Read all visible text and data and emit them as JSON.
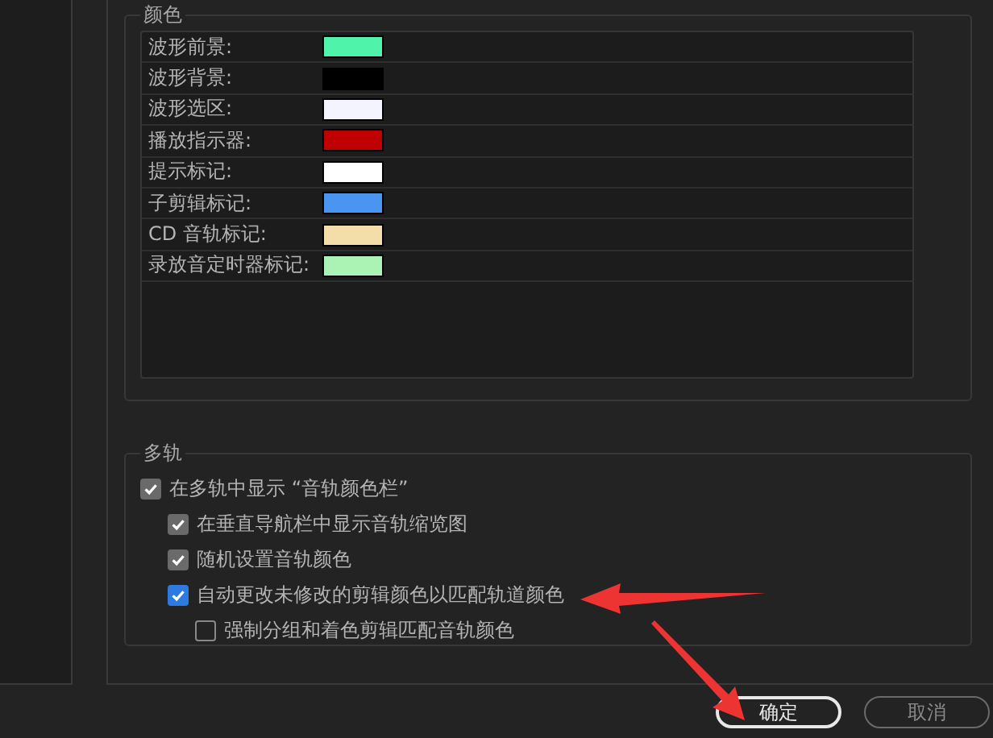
{
  "colors": {
    "title": "颜色",
    "items": [
      {
        "label": "波形前景:",
        "color": "#4ff3a9"
      },
      {
        "label": "波形背景:",
        "color": "#000000"
      },
      {
        "label": "波形选区:",
        "color": "#f4f4ff"
      },
      {
        "label": "播放指示器:",
        "color": "#c00000"
      },
      {
        "label": "提示标记:",
        "color": "#ffffff"
      },
      {
        "label": "子剪辑标记:",
        "color": "#4a94f2"
      },
      {
        "label": "CD 音轨标记:",
        "color": "#f3deaa"
      },
      {
        "label": "录放音定时器标记:",
        "color": "#abf3b5"
      }
    ]
  },
  "multitrack": {
    "title": "多轨",
    "options": [
      {
        "label": "在多轨中显示 “音轨颜色栏”",
        "checked": true,
        "disabled": true,
        "children": [
          {
            "label": "在垂直导航栏中显示音轨缩览图",
            "checked": true,
            "disabled": true
          },
          {
            "label": "随机设置音轨颜色",
            "checked": true,
            "disabled": true
          },
          {
            "label": "自动更改未修改的剪辑颜色以匹配轨道颜色",
            "checked": true,
            "disabled": false,
            "children": [
              {
                "label": "强制分组和着色剪辑匹配音轨颜色",
                "checked": false,
                "disabled": false
              }
            ]
          }
        ]
      }
    ]
  },
  "buttons": [
    {
      "label": "确定",
      "default": true
    },
    {
      "label": "取消",
      "default": false
    }
  ]
}
